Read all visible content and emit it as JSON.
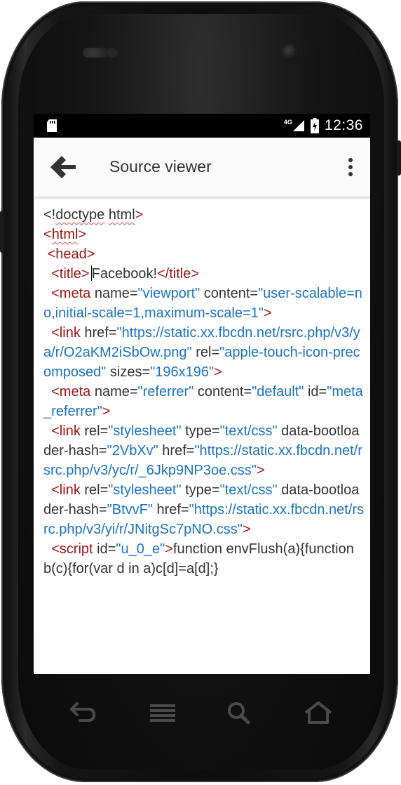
{
  "statusbar": {
    "network_label": "4G",
    "time": "12:36"
  },
  "appbar": {
    "title": "Source viewer"
  },
  "source": {
    "l1_a": "<!",
    "l1_b": "doctype",
    "l1_c": " ",
    "l1_d": "html",
    "l1_e": ">",
    "l2_a": "<",
    "l2_b": "html",
    "l2_c": ">",
    "l3": " <head>",
    "l4_a": "  <title>",
    "l4_b": "Facebook!",
    "l4_c": "</title>",
    "l5_t": "  <meta",
    "l5_n1": " name=",
    "l5_v1": "\"viewport\"",
    "l5_n2": " content=",
    "l5_v2": "\"user-scalable=no,initial-scale=1,maximum-scale=1\"",
    "l5_e": ">",
    "l6_t": "  <link",
    "l6_n1": " href=",
    "l6_v1": "\"https://static.xx.fbcdn.net/rsrc.php/v3/ya/r/O2aKM2iSbOw.png\"",
    "l6_n2": " rel=",
    "l6_v2": "\"apple-touch-icon-precomposed\"",
    "l6_n3": " sizes=",
    "l6_v3": "\"196x196\"",
    "l6_e": ">",
    "l7_t": "  <meta",
    "l7_n1": " name=",
    "l7_v1": "\"referrer\"",
    "l7_n2": " content=",
    "l7_v2": "\"default\"",
    "l7_n3": " id=",
    "l7_v3": "\"meta_referrer\"",
    "l7_e": ">",
    "l8_t": "  <link",
    "l8_n1": " rel=",
    "l8_v1": "\"stylesheet\"",
    "l8_n2": " type=",
    "l8_v2": "\"text/css\"",
    "l8_n3": " data-bootloader-hash=",
    "l8_v3": "\"2VbXv\"",
    "l8_n4": " href=",
    "l8_v4": "\"https://static.xx.fbcdn.net/rsrc.php/v3/yc/r/_6Jkp9NP3oe.css\"",
    "l8_e": ">",
    "l9_t": "  <link",
    "l9_n1": " rel=",
    "l9_v1": "\"stylesheet\"",
    "l9_n2": " type=",
    "l9_v2": "\"text/css\"",
    "l9_n3": " data-bootloader-hash=",
    "l9_v3": "\"BtvvF\"",
    "l9_n4": " href=",
    "l9_v4": "\"https://static.xx.fbcdn.net/rsrc.php/v3/yi/r/JNitgSc7pNO.css\"",
    "l9_e": ">",
    "l10_t": "  <script",
    "l10_n1": " id=",
    "l10_v1": "\"u_0_e\"",
    "l10_e": ">",
    "l10_code": "function envFlush(a){function b(c){for(var d in a)c[d]=a[d];}"
  },
  "colors": {
    "tag": "#a31515",
    "attr_value": "#1a73c9",
    "text": "#333333",
    "statusbar": "#000000",
    "appbar": "#fafafa"
  },
  "icons": {
    "back": "arrow-left-icon",
    "menu": "more-vert-icon",
    "sd": "sd-card-icon",
    "signal": "signal-icon",
    "battery": "battery-charging-icon",
    "nav_back": "nav-back-icon",
    "nav_menu": "nav-menu-icon",
    "nav_search": "nav-search-icon",
    "nav_home": "nav-home-icon"
  }
}
